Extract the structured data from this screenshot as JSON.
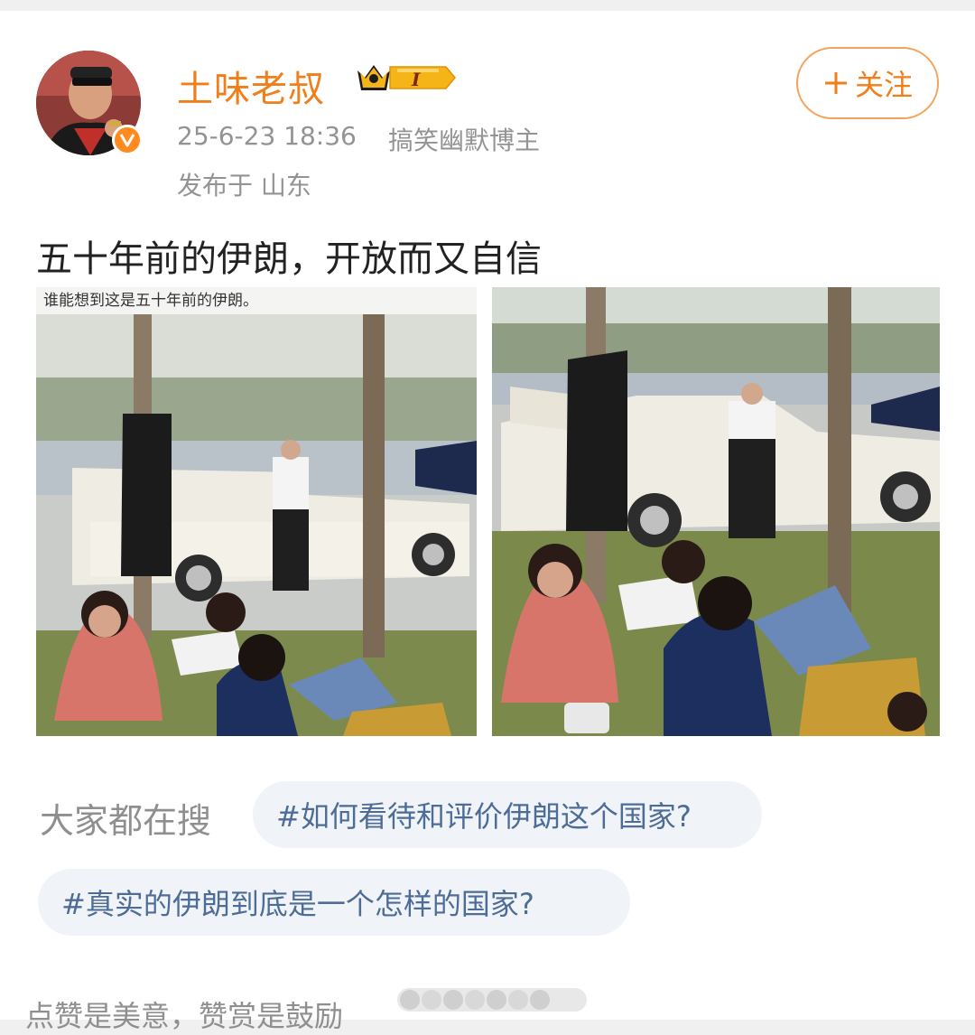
{
  "post": {
    "author": "土味老叔",
    "level_badge": "I",
    "time": "25-6-23 18:36",
    "author_role": "搞笑幽默博主",
    "location": "发布于 山东",
    "follow_label": "关注",
    "text": "五十年前的伊朗，开放而又自信",
    "photo_caption": "谁能想到这是五十年前的伊朗。"
  },
  "search": {
    "label": "大家都在搜",
    "topics": [
      "#如何看待和评价伊朗这个国家?",
      "#真实的伊朗到底是一个怎样的国家?"
    ]
  },
  "footer": {
    "text": "点赞是美意，赞赏是鼓励"
  },
  "colors": {
    "accent": "#f07f1b",
    "topic_text": "#4d6c96",
    "topic_bg": "#f0f4f9",
    "meta_text": "#939393"
  }
}
